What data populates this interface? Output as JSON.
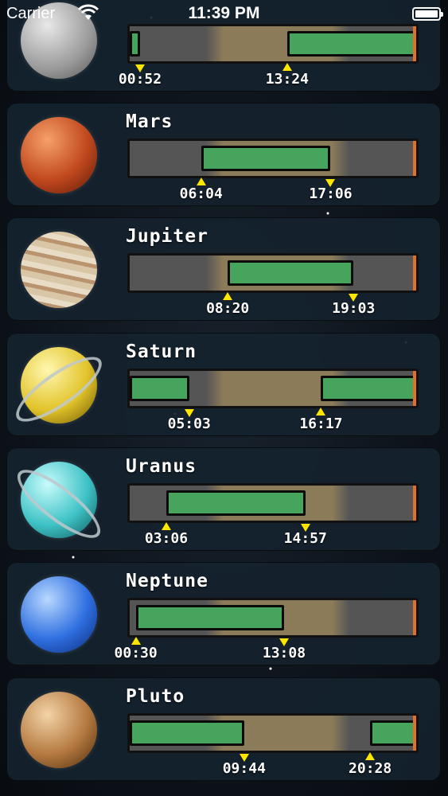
{
  "status_bar": {
    "carrier": "Carrier",
    "time": "11:39 PM"
  },
  "planets": [
    {
      "name": "",
      "rise": "13:24",
      "set": "00:52"
    },
    {
      "name": "Mars",
      "rise": "06:04",
      "set": "17:06"
    },
    {
      "name": "Jupiter",
      "rise": "08:20",
      "set": "19:03"
    },
    {
      "name": "Saturn",
      "rise": "16:17",
      "set": "05:03"
    },
    {
      "name": "Uranus",
      "rise": "03:06",
      "set": "14:57"
    },
    {
      "name": "Neptune",
      "rise": "00:30",
      "set": "13:08"
    },
    {
      "name": "Pluto",
      "rise": "20:28",
      "set": "09:44"
    }
  ],
  "timeline": {
    "day_start": "06:30",
    "day_end": "18:40",
    "now": "23:39"
  },
  "colors": {
    "visible_bar": "#46a45c",
    "night": "#555555",
    "day": "#8c7b58",
    "now_marker": "#e0702a",
    "time_marker": "#ffe600"
  },
  "icons": {
    "status": [
      "wifi-icon",
      "battery-icon"
    ],
    "planets": [
      "moon-icon",
      "mars-icon",
      "jupiter-icon",
      "saturn-icon",
      "uranus-icon",
      "neptune-icon",
      "pluto-icon"
    ]
  }
}
